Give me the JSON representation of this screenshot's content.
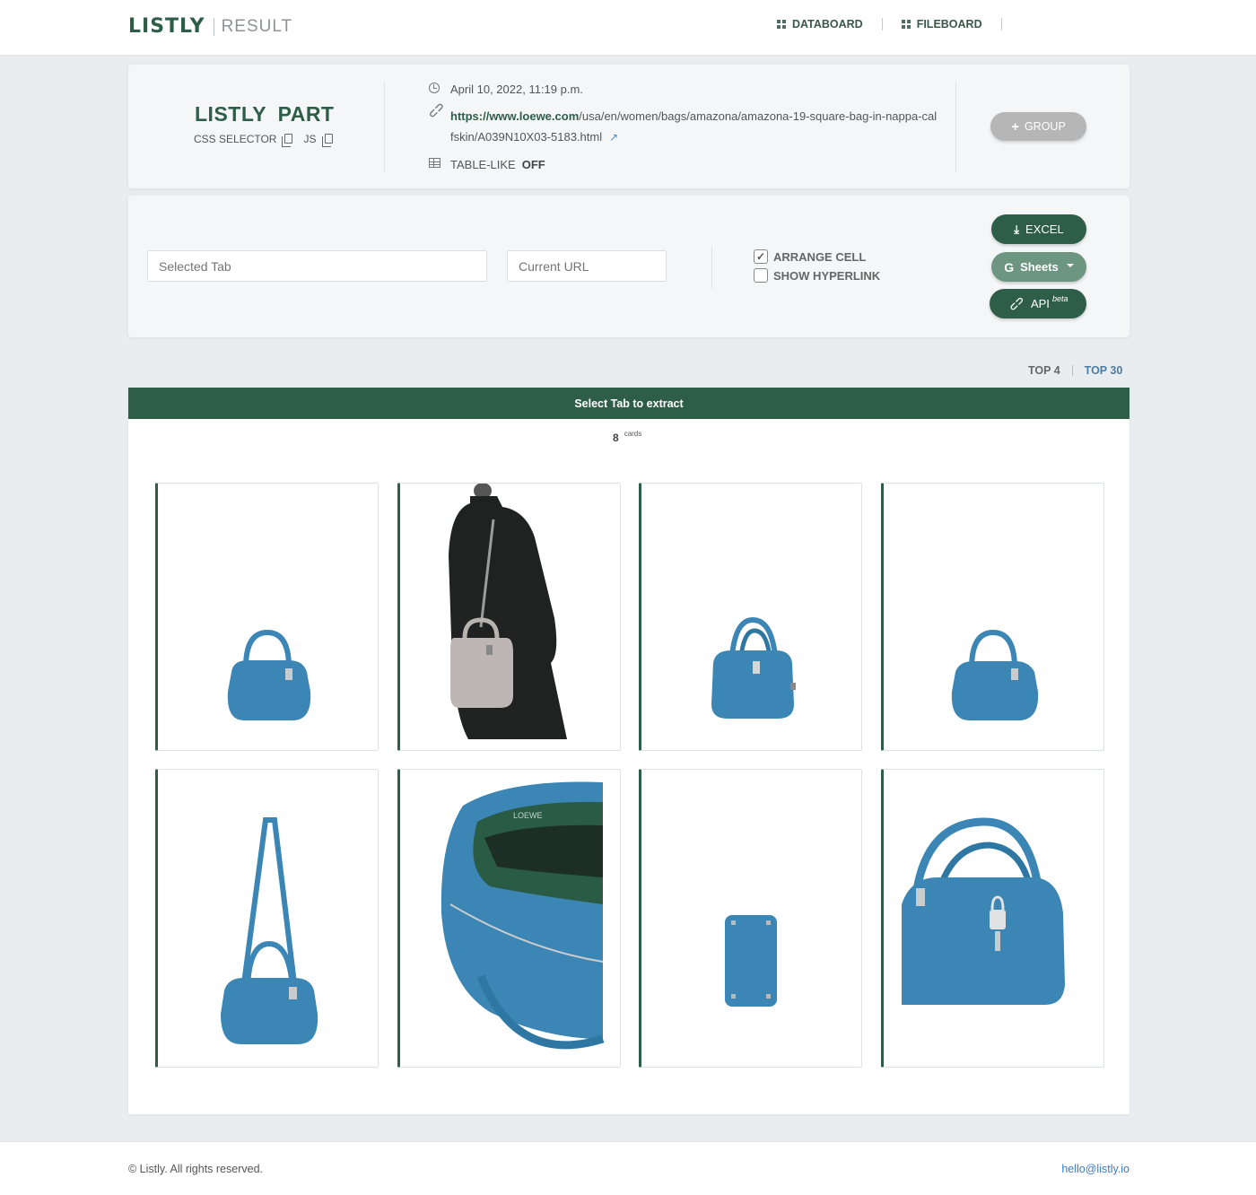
{
  "header": {
    "logo": "LISTLY",
    "section": "RESULT",
    "nav": [
      {
        "label": "DATABOARD"
      },
      {
        "label": "FILEBOARD"
      }
    ]
  },
  "info": {
    "title": "LISTLY PART",
    "css_selector_label": "CSS SELECTOR",
    "js_label": "JS",
    "timestamp": "April 10, 2022, 11:19 p.m.",
    "url_domain": "https://www.loewe.com",
    "url_path": "/usa/en/women/bags/amazona/amazona-19-square-bag-in-nappa-calfskin/A039N10X03-5183.html",
    "table_like_label": "TABLE-LIKE",
    "table_like_value": "OFF",
    "group_button": "GROUP"
  },
  "controls": {
    "selected_tab_placeholder": "Selected Tab",
    "current_url_placeholder": "Current URL",
    "arrange_cell": {
      "label": "ARRANGE CELL",
      "checked": true
    },
    "show_hyperlink": {
      "label": "SHOW HYPERLINK",
      "checked": false
    },
    "excel_button": "EXCEL",
    "sheets_button": "Sheets",
    "api_button": "API",
    "api_badge": "beta"
  },
  "top_links": {
    "top4": "TOP 4",
    "top30": "TOP 30"
  },
  "results": {
    "bar_text": "Select Tab to extract",
    "count": "8",
    "count_label": "cards",
    "cards": [
      {
        "image": "teal bag front view"
      },
      {
        "image": "model wearing grey bag"
      },
      {
        "image": "teal bag angled view"
      },
      {
        "image": "teal bag front view"
      },
      {
        "image": "teal bag with shoulder strap"
      },
      {
        "image": "bag interior close-up"
      },
      {
        "image": "bag bottom view"
      },
      {
        "image": "bag padlock detail"
      }
    ]
  },
  "colors": {
    "brand_green": "#2f5e48",
    "bag_teal": "#3b86b4",
    "link_blue": "#3b7bbf"
  },
  "footer": {
    "copyright": "© Listly. All rights reserved.",
    "email": "hello@listly.io"
  }
}
